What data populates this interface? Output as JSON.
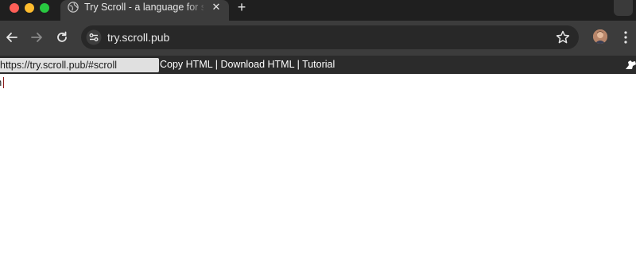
{
  "browser": {
    "tab": {
      "title": "Try Scroll - a language for scientists of all ages",
      "favicon": "globe-icon"
    },
    "window_controls": [
      "close",
      "minimize",
      "maximize"
    ],
    "toolbar": {
      "back_icon": "arrow-left-icon",
      "forward_icon": "arrow-right-icon",
      "reload_icon": "reload-icon",
      "site_info_icon": "tune-icon",
      "url": "try.scroll.pub",
      "bookmark_icon": "star-icon",
      "menu_icon": "kebab-menu-icon"
    }
  },
  "page": {
    "url_field": {
      "value": "https://try.scroll.pub/#scroll"
    },
    "links": {
      "copy_html": "Copy HTML",
      "separator": "|",
      "download_html": "Download HTML",
      "tutorial": "Tutorial"
    },
    "header_icon": "fork-icon",
    "editor": {
      "text": "n"
    }
  },
  "colors": {
    "tabstrip_bg": "#1f1f1f",
    "toolbar_bg": "#3c3c3c",
    "omnibox_bg": "#282828",
    "page_header_bg": "#2b2b2b",
    "url_field_bg": "#e0e0e0",
    "traffic_close": "#ff5f57",
    "traffic_minimize": "#febc2e",
    "traffic_maximize": "#28c840"
  }
}
